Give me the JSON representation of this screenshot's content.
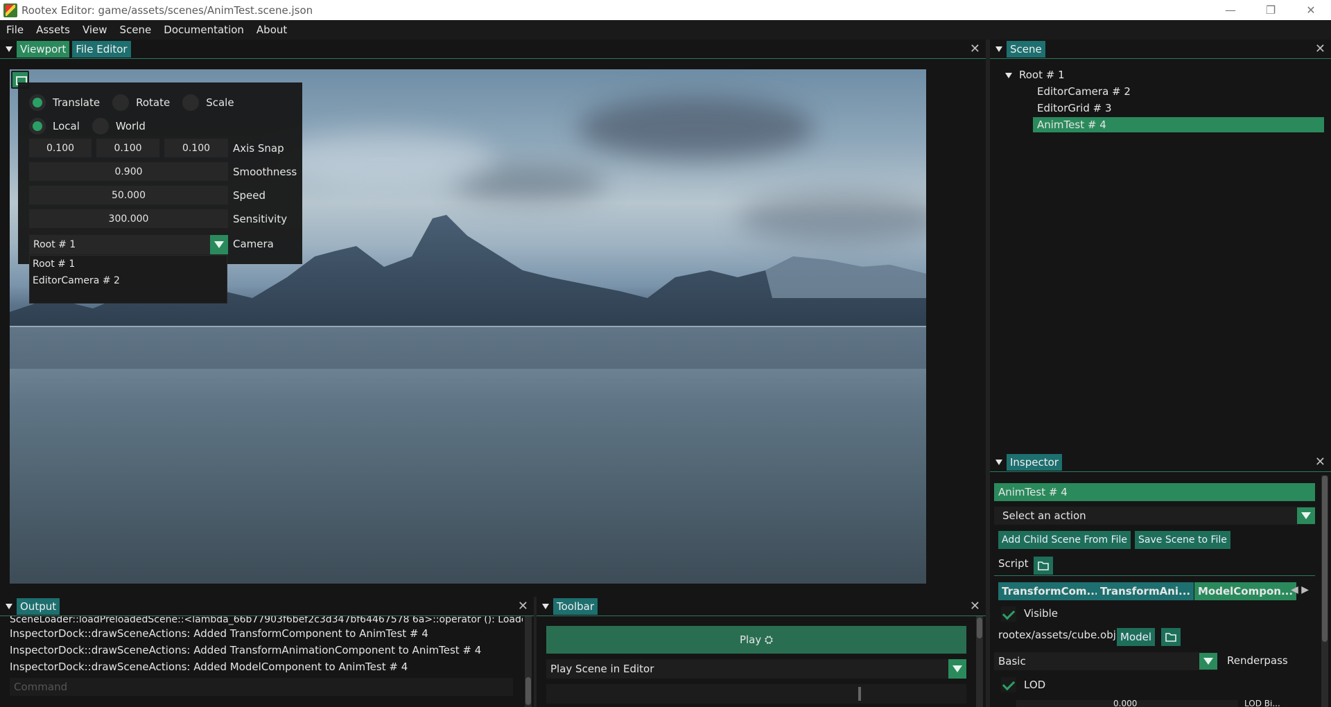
{
  "window": {
    "title": "Rootex Editor: game/assets/scenes/AnimTest.scene.json",
    "controls": [
      "—",
      "❐",
      "✕"
    ]
  },
  "menu": [
    "File",
    "Assets",
    "View",
    "Scene",
    "Documentation",
    "About"
  ],
  "viewport_dock": {
    "tabs": [
      "Viewport",
      "File Editor"
    ],
    "close": "✕"
  },
  "gizmo": {
    "operations": [
      {
        "label": "Translate",
        "selected": true
      },
      {
        "label": "Rotate",
        "selected": false
      },
      {
        "label": "Scale",
        "selected": false
      }
    ],
    "modes": [
      {
        "label": "Local",
        "selected": true
      },
      {
        "label": "World",
        "selected": false
      }
    ],
    "axis_snap": [
      "0.100",
      "0.100",
      "0.100"
    ],
    "axis_snap_label": "Axis Snap",
    "smoothness": "0.900",
    "smoothness_label": "Smoothness",
    "speed": "50.000",
    "speed_label": "Speed",
    "sensitivity": "300.000",
    "sensitivity_label": "Sensitivity",
    "camera_value": "Root # 1",
    "camera_label": "Camera",
    "camera_options": [
      "Root # 1",
      "EditorCamera # 2"
    ]
  },
  "scene_dock": {
    "tab": "Scene",
    "close": "✕",
    "tree": [
      {
        "label": "Root # 1",
        "selected": false
      },
      {
        "label": "EditorCamera # 2",
        "selected": false
      },
      {
        "label": "EditorGrid # 3",
        "selected": false
      },
      {
        "label": "AnimTest # 4",
        "selected": true
      }
    ]
  },
  "inspector": {
    "tab": "Inspector",
    "close": "✕",
    "entity": "AnimTest # 4",
    "action_placeholder": "Select an action",
    "add_child_label": "Add Child Scene From File",
    "save_scene_label": "Save Scene to File",
    "script_label": "Script",
    "component_tabs": [
      {
        "label": "TransformCom...",
        "active": false
      },
      {
        "label": "TransformAni...",
        "active": false
      },
      {
        "label": "ModelCompon...",
        "active": true
      }
    ],
    "visible_label": "Visible",
    "model_path": "rootex/assets/cube.obj",
    "model_button": "Model",
    "renderpass_value": "Basic",
    "renderpass_label": "Renderpass",
    "lod_label": "LOD",
    "lod_value_partial": "0.000",
    "lod_label_partial": "LOD Bi..."
  },
  "output_dock": {
    "tab": "Output",
    "close": "✕",
    "lines": [
      "SceneLoader::loadPreloadedScene::<lambda_66b77903f6bef2c3d347bf64467578 6a>::operator (): Loaded scene",
      "InspectorDock::drawSceneActions: Added TransformComponent to AnimTest # 4",
      "InspectorDock::drawSceneActions: Added TransformAnimationComponent to AnimTest # 4",
      "InspectorDock::drawSceneActions: Added ModelComponent to AnimTest # 4"
    ],
    "command_placeholder": "Command"
  },
  "toolbar_dock": {
    "tab": "Toolbar",
    "close": "✕",
    "play_label": "Play ⛭",
    "play_mode_value": "Play Scene in Editor"
  },
  "colors": {
    "accent": "#2a8a5c",
    "tab_inactive": "#1e6f6f",
    "panel": "#151515"
  }
}
